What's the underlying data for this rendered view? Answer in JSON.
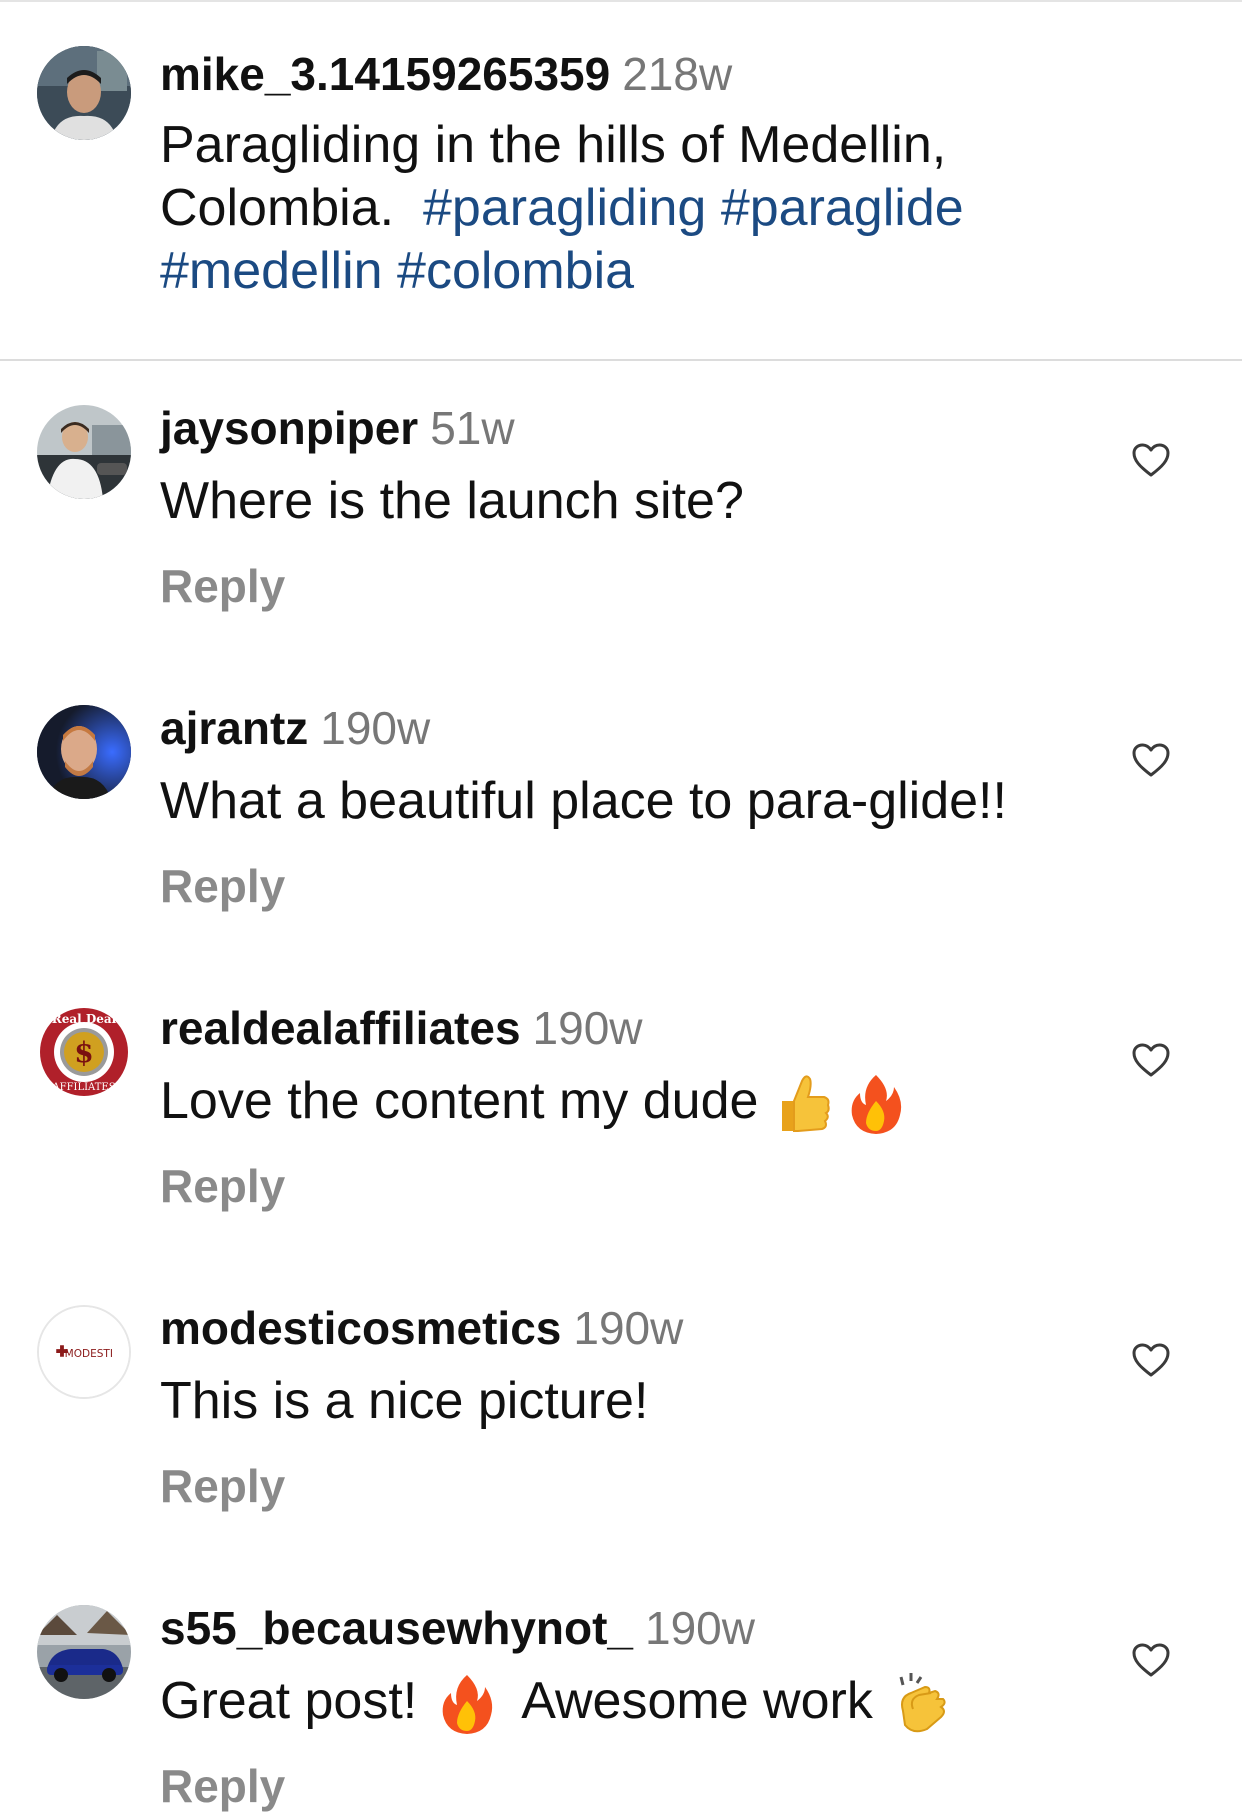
{
  "caption": {
    "username": "mike_3.14159265359",
    "time": "218w",
    "text_line1": "Paragliding in the hills of Medellin,",
    "text_line2_plain": "Colombia.",
    "hashtags_line2": [
      "#paragliding",
      "#paraglide"
    ],
    "hashtags_line3": [
      "#medellin",
      "#colombia"
    ]
  },
  "comments": [
    {
      "username": "jaysonpiper",
      "time": "51w",
      "text": "Where is the launch site?",
      "reply_label": "Reply"
    },
    {
      "username": "ajrantz",
      "time": "190w",
      "text": "What a beautiful place to para-glide!!",
      "reply_label": "Reply"
    },
    {
      "username": "realdealaffiliates",
      "time": "190w",
      "text": "Love the content my dude",
      "emojis": [
        "thumbs-up",
        "fire"
      ],
      "avatar_text_top": "Real Deal",
      "avatar_text_bottom": "AFFILIATES",
      "avatar_symbol": "$",
      "reply_label": "Reply"
    },
    {
      "username": "modesticosmetics",
      "time": "190w",
      "text": "This is a nice picture!",
      "avatar_text": "MODESTI",
      "reply_label": "Reply"
    },
    {
      "username": "s55_becausewhynot_",
      "time": "190w",
      "text_part1": "Great post!",
      "emoji_mid": "fire",
      "text_part2": "Awesome work",
      "emoji_end": "clapping-hands",
      "reply_label": "Reply"
    }
  ],
  "colors": {
    "hashtag": "#1b4a82",
    "secondary_text": "#777777",
    "reply": "#8a8a8a",
    "divider": "#dcdcdc"
  }
}
